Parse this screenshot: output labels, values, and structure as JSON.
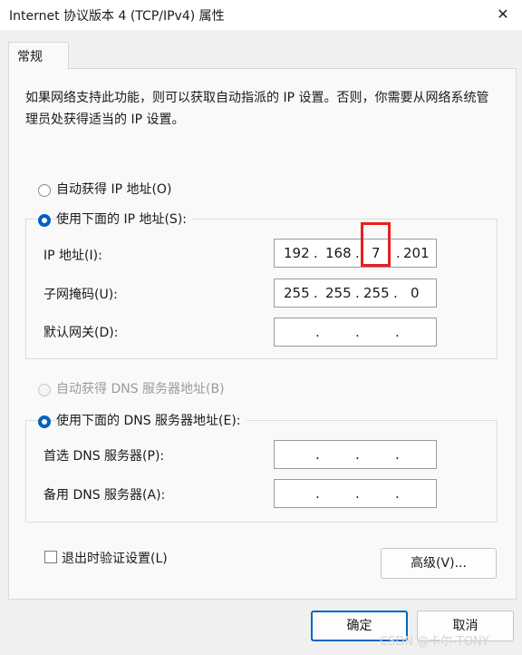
{
  "window": {
    "title": "Internet 协议版本 4 (TCP/IPv4) 属性"
  },
  "tabs": [
    {
      "label": "常规"
    }
  ],
  "description": "如果网络支持此功能，则可以获取自动指派的 IP 设置。否则，你需要从网络系统管理员处获得适当的 IP 设置。",
  "ip_section": {
    "auto_label": "自动获得 IP 地址(O)",
    "manual_label": "使用下面的 IP 地址(S):",
    "selected": "manual",
    "fields": [
      {
        "label": "IP 地址(I):",
        "octets": [
          "192",
          "168",
          "7",
          "201"
        ]
      },
      {
        "label": "子网掩码(U):",
        "octets": [
          "255",
          "255",
          "255",
          "0"
        ]
      },
      {
        "label": "默认网关(D):",
        "octets": [
          "",
          "",
          "",
          ""
        ]
      }
    ]
  },
  "dns_section": {
    "auto_label": "自动获得 DNS 服务器地址(B)",
    "manual_label": "使用下面的 DNS 服务器地址(E):",
    "selected": "manual",
    "fields": [
      {
        "label": "首选 DNS 服务器(P):",
        "octets": [
          "",
          "",
          "",
          ""
        ]
      },
      {
        "label": "备用 DNS 服务器(A):",
        "octets": [
          "",
          "",
          "",
          ""
        ]
      }
    ]
  },
  "validate_on_exit_label": "退出时验证设置(L)",
  "validate_on_exit_checked": false,
  "buttons": {
    "advanced": "高级(V)...",
    "ok": "确定",
    "cancel": "取消"
  },
  "watermark": "CSDN @卡尔-TONY",
  "colors": {
    "accent": "#0067c0",
    "highlight": "#e81f1f"
  }
}
